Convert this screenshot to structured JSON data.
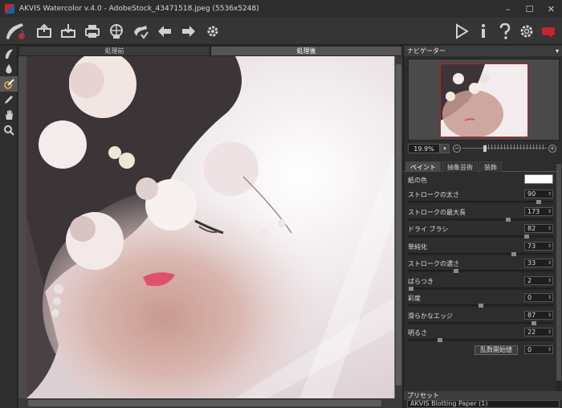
{
  "window": {
    "title": "AKVIS Watercolor v.4.0 - AdobeStock_43471518.jpeg (5536x5248)",
    "minimize": "–",
    "maximize": "☐",
    "close": "✕"
  },
  "colors": {
    "accent_red": "#c8242a",
    "panel_bg": "#2d2d2d",
    "toolbar_bg": "#353535"
  },
  "toolbar": {
    "left": [
      "app-logo-icon",
      "open-icon",
      "save-icon",
      "print-icon",
      "share-icon",
      "batch-icon",
      "undo-icon",
      "redo-icon",
      "settings-gear-icon"
    ],
    "right": [
      "run-icon",
      "info-icon",
      "help-icon",
      "preferences-icon",
      "notification-icon"
    ]
  },
  "tools": [
    "brush-icon",
    "drop-icon",
    "eraser-brush-icon",
    "pencil-icon",
    "hand-icon",
    "zoom-icon"
  ],
  "canvas": {
    "tab_before": "処理前",
    "tab_after": "処理後"
  },
  "navigator": {
    "title": "ナビゲーター",
    "zoom": "19.9%",
    "zoom_fraction": 0.08
  },
  "settings": {
    "tabs": [
      "ペイント",
      "抽象芸術",
      "装飾"
    ],
    "paper_color_label": "紙の色",
    "paper_color": "#ffffff",
    "params": [
      {
        "label": "ストロークの太さ",
        "value": "90",
        "level": 0.9
      },
      {
        "label": "ストロークの最大長",
        "value": "173",
        "level": 0.69
      },
      {
        "label": "ドライ ブラシ",
        "value": "82",
        "level": 0.82
      },
      {
        "label": "単純化",
        "value": "73",
        "level": 0.73
      },
      {
        "label": "ストロークの濃さ",
        "value": "33",
        "level": 0.33
      },
      {
        "label": "ばらつき",
        "value": "2",
        "level": 0.02
      },
      {
        "label": "彩度",
        "value": "0",
        "level": 0.5
      },
      {
        "label": "滑らかなエッジ",
        "value": "87",
        "level": 0.87
      },
      {
        "label": "明るさ",
        "value": "22",
        "level": 0.22
      }
    ],
    "seed_button": "乱数開始値",
    "seed_value": "0"
  },
  "presets": {
    "title": "プリセット",
    "selected": "AKVIS Blotting Paper (1)"
  }
}
